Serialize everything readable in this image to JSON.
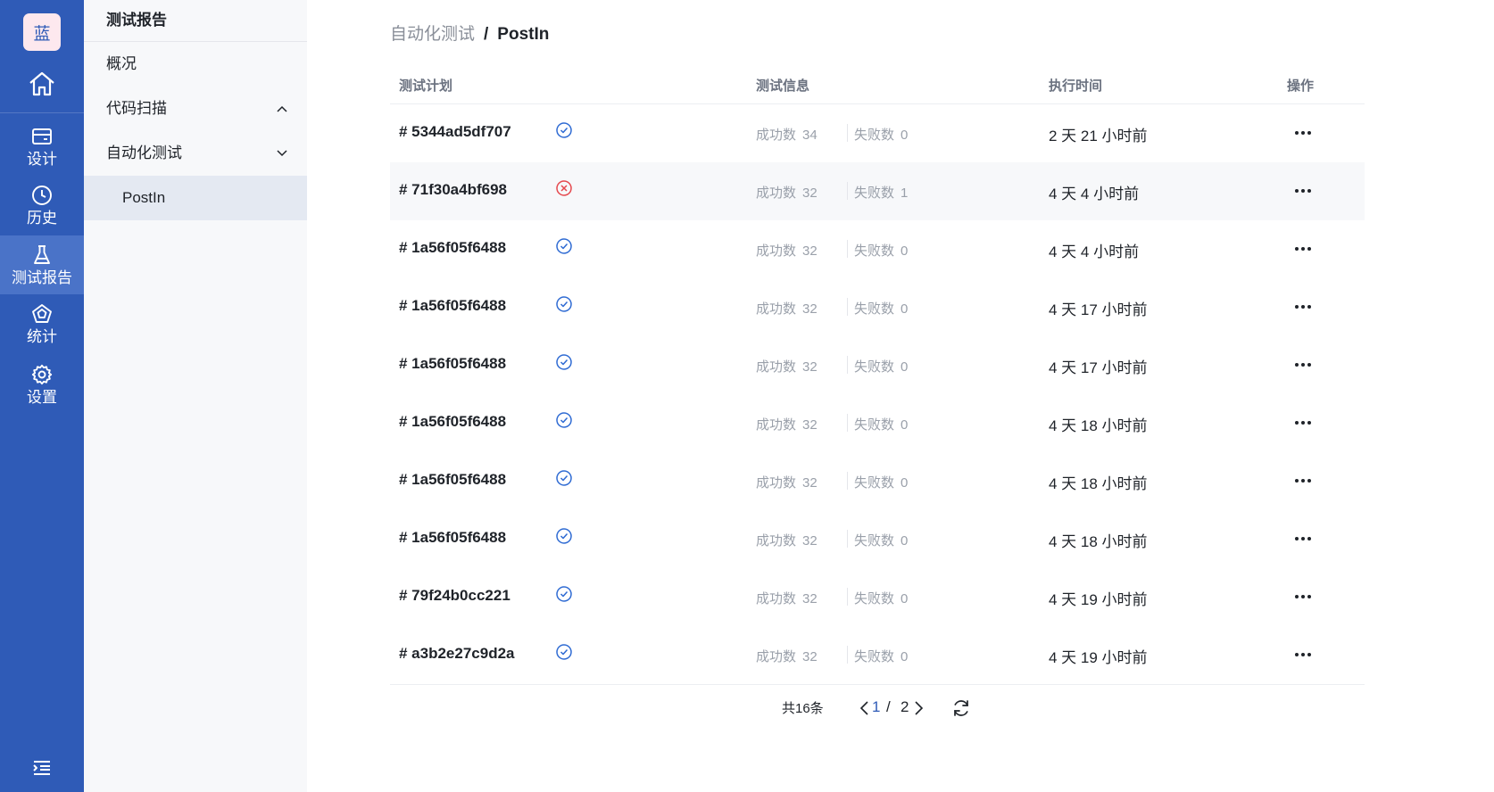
{
  "rail": {
    "logo": "蓝",
    "items": [
      {
        "label": "设计",
        "icon": "design-icon"
      },
      {
        "label": "历史",
        "icon": "clock-icon"
      },
      {
        "label": "测试报告",
        "icon": "flask-icon"
      },
      {
        "label": "统计",
        "icon": "pentagon-icon"
      },
      {
        "label": "设置",
        "icon": "gear-icon"
      }
    ],
    "active_label": "测试报告",
    "accent": "#2f5bb7"
  },
  "sidebar": {
    "title": "测试报告",
    "items": [
      {
        "label": "概况"
      },
      {
        "label": "代码扫描",
        "chevron": "up"
      },
      {
        "label": "自动化测试",
        "chevron": "down"
      },
      {
        "label": "PostIn",
        "sub": true,
        "selected": true
      }
    ]
  },
  "breadcrumb": {
    "parent": "自动化测试",
    "separator": "/",
    "current": "PostIn"
  },
  "table": {
    "headers": {
      "plan": "测试计划",
      "info": "测试信息",
      "time": "执行时间",
      "action": "操作"
    },
    "success_label": "成功数",
    "fail_label": "失败数",
    "rows": [
      {
        "plan": "# 5344ad5df707",
        "status": "pass",
        "success": "34",
        "fail": "0",
        "time": "2 天 21 小时前"
      },
      {
        "plan": "# 71f30a4bf698",
        "status": "fail",
        "success": "32",
        "fail": "1",
        "time": "4 天 4 小时前"
      },
      {
        "plan": "# 1a56f05f6488",
        "status": "pass",
        "success": "32",
        "fail": "0",
        "time": "4 天 4 小时前"
      },
      {
        "plan": "# 1a56f05f6488",
        "status": "pass",
        "success": "32",
        "fail": "0",
        "time": "4 天 17 小时前"
      },
      {
        "plan": "# 1a56f05f6488",
        "status": "pass",
        "success": "32",
        "fail": "0",
        "time": "4 天 17 小时前"
      },
      {
        "plan": "# 1a56f05f6488",
        "status": "pass",
        "success": "32",
        "fail": "0",
        "time": "4 天 18 小时前"
      },
      {
        "plan": "# 1a56f05f6488",
        "status": "pass",
        "success": "32",
        "fail": "0",
        "time": "4 天 18 小时前"
      },
      {
        "plan": "# 1a56f05f6488",
        "status": "pass",
        "success": "32",
        "fail": "0",
        "time": "4 天 18 小时前"
      },
      {
        "plan": "# 79f24b0cc221",
        "status": "pass",
        "success": "32",
        "fail": "0",
        "time": "4 天 19 小时前"
      },
      {
        "plan": "# a3b2e27c9d2a",
        "status": "pass",
        "success": "32",
        "fail": "0",
        "time": "4 天 19 小时前"
      }
    ],
    "status_colors": {
      "pass": "#2f6bd3",
      "fail": "#e5484d"
    }
  },
  "pagination": {
    "total": "共16条",
    "current": "1",
    "separator": "/",
    "pages": "2"
  }
}
